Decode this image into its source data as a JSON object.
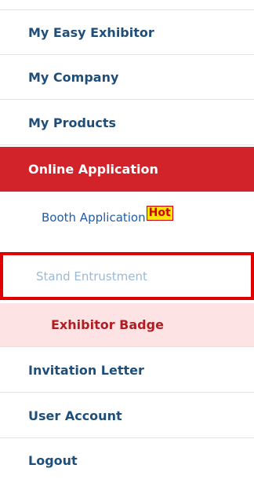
{
  "menu": {
    "items": [
      {
        "label": "My Easy Exhibitor"
      },
      {
        "label": "My Company"
      },
      {
        "label": "My Products"
      },
      {
        "label": "Online Application"
      },
      {
        "label": "Invitation Letter"
      },
      {
        "label": "User Account"
      },
      {
        "label": "Logout"
      }
    ],
    "subitems": [
      {
        "label": "Booth Application",
        "badge": "Hot"
      },
      {
        "label": "Stand Entrustment"
      },
      {
        "label": "Exhibitor Badge"
      }
    ]
  },
  "colors": {
    "active_bg": "#d2232a",
    "link_text": "#1f4e79",
    "current_bg": "#fde3e3",
    "hot_badge_bg": "#ffe600",
    "highlight_border": "#e00000"
  }
}
